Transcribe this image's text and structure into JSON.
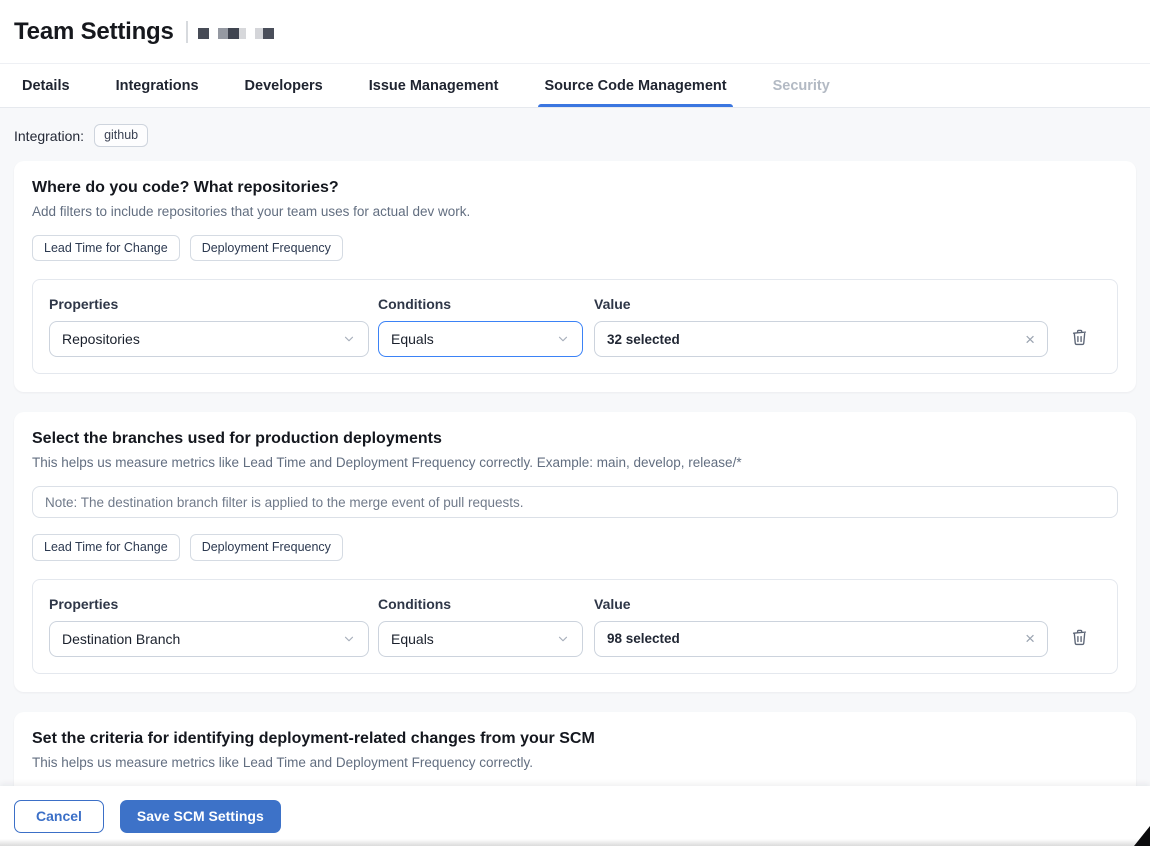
{
  "header": {
    "title": "Team Settings"
  },
  "tabs": [
    {
      "label": "Details"
    },
    {
      "label": "Integrations"
    },
    {
      "label": "Developers"
    },
    {
      "label": "Issue Management"
    },
    {
      "label": "Source Code Management",
      "active": true
    },
    {
      "label": "Security",
      "disabled": true
    }
  ],
  "integration": {
    "label": "Integration:",
    "value": "github"
  },
  "cards": [
    {
      "title": "Where do you code? What repositories?",
      "subtitle": "Add filters to include repositories that your team uses for actual dev work.",
      "badges": [
        "Lead Time for Change",
        "Deployment Frequency"
      ],
      "filter": {
        "properties_label": "Properties",
        "conditions_label": "Conditions",
        "value_label": "Value",
        "property": "Repositories",
        "condition": "Equals",
        "value": "32 selected"
      }
    },
    {
      "title": "Select the branches used for production deployments",
      "subtitle": "This helps us measure metrics like Lead Time and Deployment Frequency correctly. Example: main, develop, release/*",
      "note_placeholder": "Note: The destination branch filter is applied to the merge event of pull requests.",
      "badges": [
        "Lead Time for Change",
        "Deployment Frequency"
      ],
      "filter": {
        "properties_label": "Properties",
        "conditions_label": "Conditions",
        "value_label": "Value",
        "property": "Destination Branch",
        "condition": "Equals",
        "value": "98 selected"
      }
    },
    {
      "title": "Set the criteria for identifying deployment-related changes from your SCM",
      "subtitle": "This helps us measure metrics like Lead Time and Deployment Frequency correctly."
    }
  ],
  "footer": {
    "cancel_label": "Cancel",
    "save_label": "Save SCM Settings"
  },
  "icons": {
    "clear": "×"
  },
  "colors": {
    "accent_blue": "#3b82f6",
    "tab_active_underline": "#3b76e0",
    "save_button_blue": "#3d72c8",
    "content_background": "#f7f8fa"
  }
}
